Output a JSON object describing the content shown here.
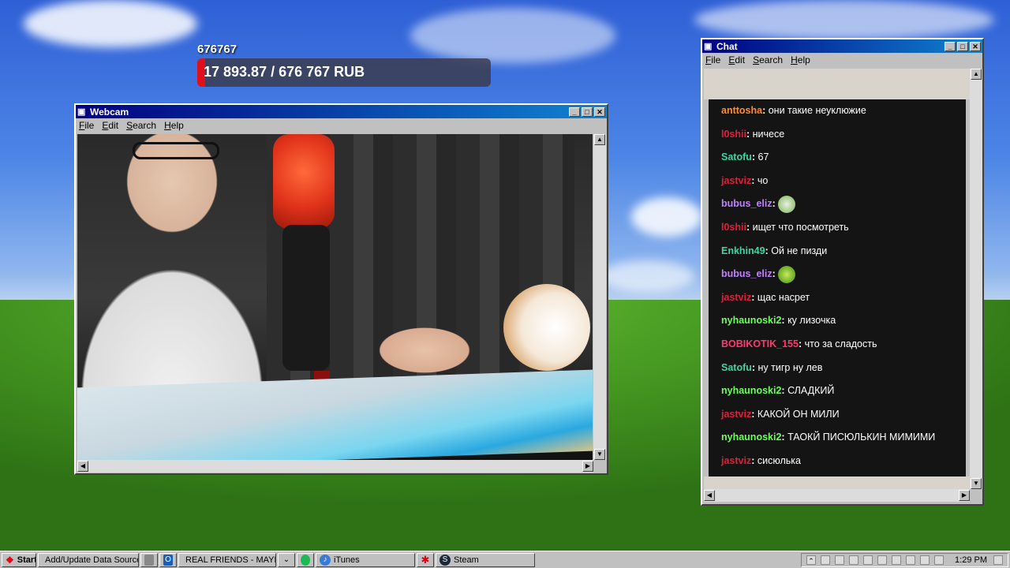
{
  "donation": {
    "title": "676767",
    "progress_text": "17 893.87 / 676 767 RUB",
    "progress_fraction": 0.026,
    "fill_color": "#e0101a"
  },
  "webcam_window": {
    "title": "Webcam",
    "menu": [
      "File",
      "Edit",
      "Search",
      "Help"
    ]
  },
  "chat_window": {
    "title": "Chat",
    "menu": [
      "File",
      "Edit",
      "Search",
      "Help"
    ],
    "messages": [
      {
        "user": "anttosha",
        "text": "они такие неуклюжие",
        "color": "#ff8c3a"
      },
      {
        "user": "l0shii",
        "text": "ничесе",
        "color": "#e0203a"
      },
      {
        "user": "Satofu",
        "text": "67",
        "color": "#3ad8a0"
      },
      {
        "user": "jastviz",
        "text": "чо",
        "color": "#e0203a"
      },
      {
        "user": "bubus_eliz",
        "text": "",
        "color": "#c080ff",
        "emote": "face-emote"
      },
      {
        "user": "l0shii",
        "text": "ищет что посмотреть",
        "color": "#e0203a"
      },
      {
        "user": "Enkhin49",
        "text": "Ой не пизди",
        "color": "#3ad8a0"
      },
      {
        "user": "bubus_eliz",
        "text": "",
        "color": "#c080ff",
        "emote": "blob-emote"
      },
      {
        "user": "jastviz",
        "text": "щас насрет",
        "color": "#e0203a"
      },
      {
        "user": "nyhaunoski2",
        "text": "ку лизочка",
        "color": "#6cff5a"
      },
      {
        "user": "BOBIKOTIK_155",
        "text": "что за сладость",
        "color": "#ff3a6a"
      },
      {
        "user": "Satofu",
        "text": "ну тигр ну лев",
        "color": "#3ad8a0"
      },
      {
        "user": "nyhaunoski2",
        "text": "СЛАДКИЙ",
        "color": "#6cff5a"
      },
      {
        "user": "jastviz",
        "text": "КАКОЙ ОН МИЛИ",
        "color": "#e0203a"
      },
      {
        "user": "nyhaunoski2",
        "text": "ТАОКЙ ПИСЮЛЬКИН МИМИМИ",
        "color": "#6cff5a"
      },
      {
        "user": "jastviz",
        "text": "сисюлька",
        "color": "#e0203a"
      }
    ]
  },
  "taskbar": {
    "start_label": "Start",
    "buttons": [
      {
        "label": "Add/Update Data Source...",
        "icon": "chrome-icon"
      },
      {
        "label": "",
        "icon": "calculator-icon"
      },
      {
        "label": "",
        "icon": "outlook-icon"
      },
      {
        "label": "REAL FRIENDS - MAYB...",
        "icon": "folder-icon"
      },
      {
        "label": "",
        "icon": "chevron-icon"
      },
      {
        "label": "",
        "icon": "spotify-icon"
      },
      {
        "label": "iTunes",
        "icon": "itunes-icon"
      },
      {
        "label": "",
        "icon": "asterisk-icon"
      },
      {
        "label": "Steam",
        "icon": "steam-icon"
      }
    ],
    "clock": "1:29 PM"
  }
}
